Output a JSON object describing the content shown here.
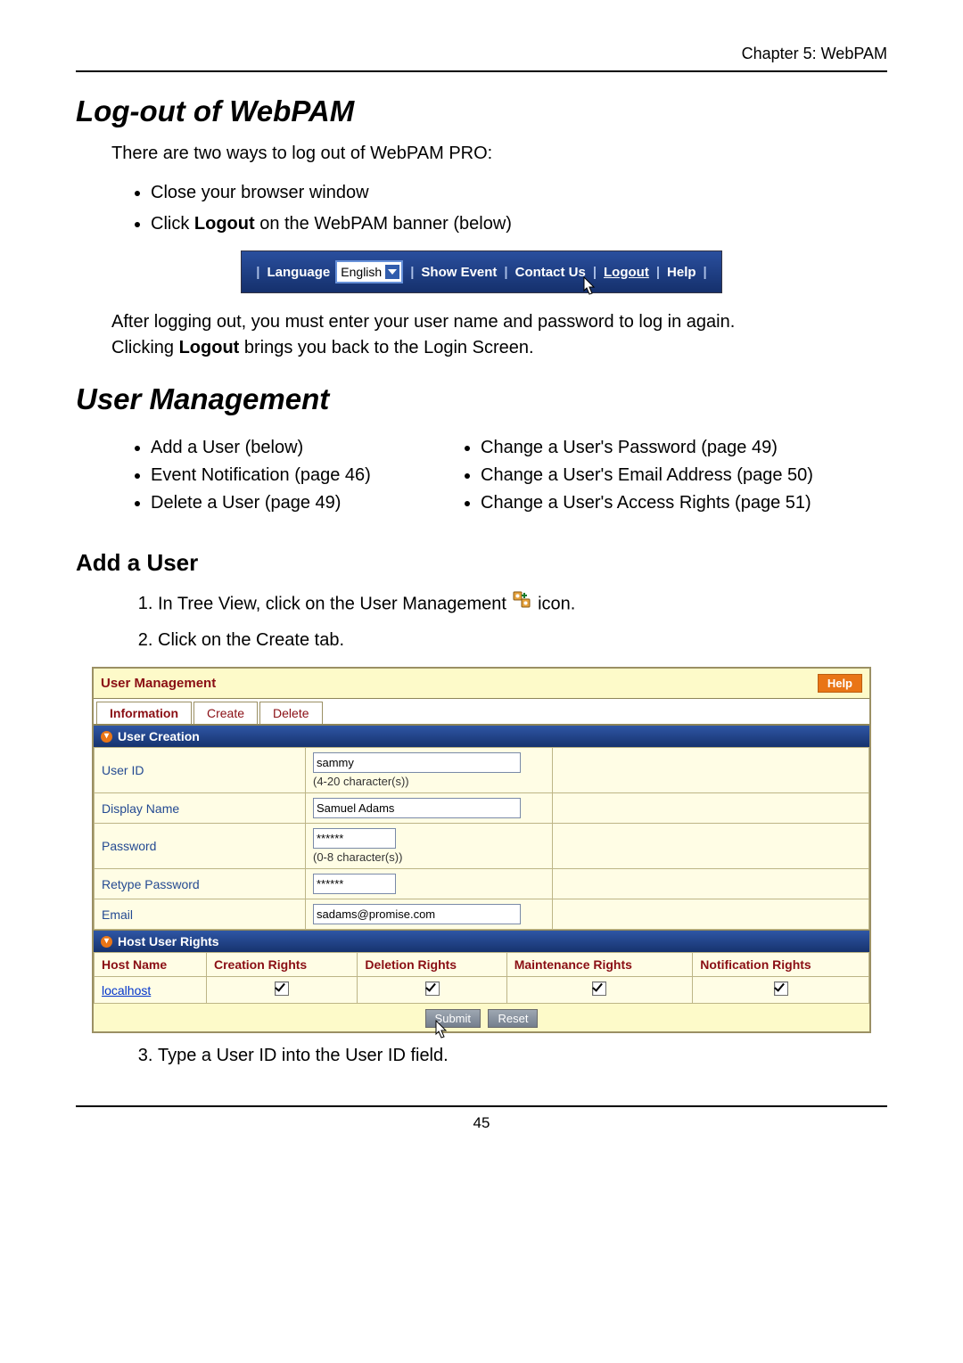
{
  "chapter": "Chapter 5: WebPAM",
  "section1": {
    "title": "Log-out of WebPAM",
    "intro": "There are two ways to log out of WebPAM PRO:",
    "bullets": {
      "b1": "Close your browser window",
      "b2_pre": "Click ",
      "b2_bold": "Logout",
      "b2_post": " on the WebPAM banner (below)"
    },
    "after1": "After logging out, you must enter your user name and password to log in again.",
    "after2_pre": "Clicking ",
    "after2_bold": "Logout",
    "after2_post": " brings you back to the Login Screen."
  },
  "banner": {
    "language_label": "Language",
    "language_value": "English",
    "show_event": "Show Event",
    "contact_us": "Contact Us",
    "logout": "Logout",
    "help": "Help"
  },
  "section2": {
    "title": "User Management",
    "left": {
      "i1": "Add a User (below)",
      "i2": "Event Notification (page 46)",
      "i3": "Delete a User (page 49)"
    },
    "right": {
      "i1": "Change a User's Password (page 49)",
      "i2": "Change a User's Email Address (page 50)",
      "i3": "Change a User's Access Rights (page 51)"
    }
  },
  "addUser": {
    "title": "Add a User",
    "step1_pre": "In Tree View, click on the User Management ",
    "step1_post": " icon.",
    "step2": "Click on the Create tab.",
    "step3": "Type a User ID into the User ID field."
  },
  "panel": {
    "title": "User Management",
    "help": "Help",
    "tabs": {
      "t1": "Information",
      "t2": "Create",
      "t3": "Delete"
    },
    "sec1": "User Creation",
    "fields": {
      "userid_label": "User ID",
      "userid_value": "sammy",
      "userid_hint": "(4-20 character(s))",
      "display_label": "Display Name",
      "display_value": "Samuel Adams",
      "pw_label": "Password",
      "pw_value": "******",
      "pw_hint": "(0-8 character(s))",
      "rpw_label": "Retype Password",
      "rpw_value": "******",
      "email_label": "Email",
      "email_value": "sadams@promise.com"
    },
    "sec2": "Host User Rights",
    "rights": {
      "h1": "Host Name",
      "h2": "Creation Rights",
      "h3": "Deletion Rights",
      "h4": "Maintenance Rights",
      "h5": "Notification Rights",
      "host": "localhost"
    },
    "buttons": {
      "submit": "Submit",
      "reset": "Reset"
    }
  },
  "pageNumber": "45"
}
